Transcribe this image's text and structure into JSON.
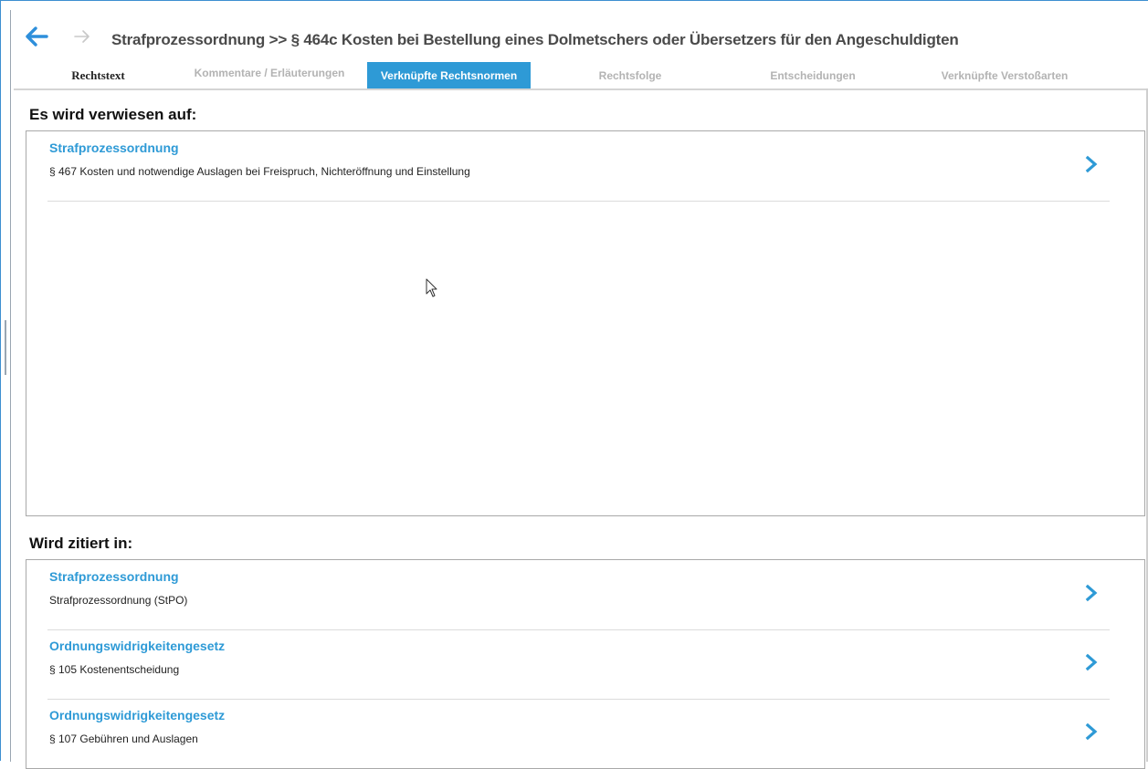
{
  "header": {
    "title": "Strafprozessordnung >> § 464c Kosten bei Bestellung eines Dolmetschers oder Übersetzers für den Angeschuldigten"
  },
  "tabs": [
    {
      "label": "Rechtstext"
    },
    {
      "label": "Kommentare / Erläuterungen"
    },
    {
      "label": "Verknüpfte Rechtsnormen"
    },
    {
      "label": "Rechtsfolge"
    },
    {
      "label": "Entscheidungen"
    },
    {
      "label": "Verknüpfte Verstoßarten"
    }
  ],
  "references": {
    "heading": "Es wird verwiesen auf:",
    "items": [
      {
        "title": "Strafprozessordnung",
        "subtitle": "§ 467 Kosten und notwendige Auslagen bei Freispruch, Nichteröffnung und Einstellung"
      }
    ]
  },
  "citations": {
    "heading": "Wird zitiert in:",
    "items": [
      {
        "title": "Strafprozessordnung",
        "subtitle": "Strafprozessordnung (StPO)"
      },
      {
        "title": "Ordnungswidrigkeitengesetz",
        "subtitle": "§ 105 Kostenentscheidung"
      },
      {
        "title": "Ordnungswidrigkeitengesetz",
        "subtitle": "§ 107 Gebühren und Auslagen"
      }
    ]
  },
  "colors": {
    "accent": "#2e9ad6",
    "back_arrow": "#2e8fdb",
    "forward_arrow_disabled": "#c8c8c8"
  },
  "icons": {
    "back": "arrow-left-icon",
    "forward": "arrow-right-icon",
    "item_chevron": "chevron-right-icon"
  },
  "active_tab": "Verknüpfte Rechtsnormen"
}
